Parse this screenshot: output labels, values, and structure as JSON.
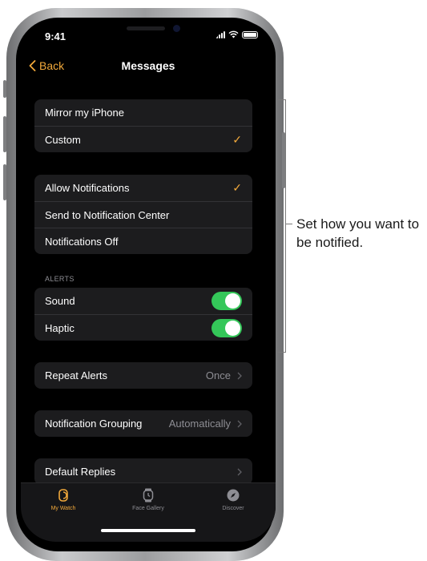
{
  "status": {
    "time": "9:41"
  },
  "nav": {
    "back_label": "Back",
    "title": "Messages"
  },
  "mirror_group": {
    "items": [
      {
        "label": "Mirror my iPhone",
        "checked": false
      },
      {
        "label": "Custom",
        "checked": true
      }
    ]
  },
  "notification_group": {
    "items": [
      {
        "label": "Allow Notifications",
        "checked": true
      },
      {
        "label": "Send to Notification Center",
        "checked": false
      },
      {
        "label": "Notifications Off",
        "checked": false
      }
    ]
  },
  "alerts": {
    "header": "ALERTS",
    "items": [
      {
        "label": "Sound",
        "on": true
      },
      {
        "label": "Haptic",
        "on": true
      }
    ]
  },
  "repeat_alerts": {
    "label": "Repeat Alerts",
    "value": "Once"
  },
  "notification_grouping": {
    "label": "Notification Grouping",
    "value": "Automatically"
  },
  "default_replies": {
    "label": "Default Replies"
  },
  "tabbar": {
    "tabs": [
      {
        "label": "My Watch",
        "icon": "watch-icon",
        "active": true
      },
      {
        "label": "Face Gallery",
        "icon": "face-gallery-icon",
        "active": false
      },
      {
        "label": "Discover",
        "icon": "compass-icon",
        "active": false
      }
    ]
  },
  "callout": {
    "text": "Set how you want to be notified."
  },
  "colors": {
    "accent": "#f2a93b",
    "toggle_on": "#34c759",
    "cell_bg": "#1c1c1e",
    "secondary_text": "#8d8d93"
  }
}
